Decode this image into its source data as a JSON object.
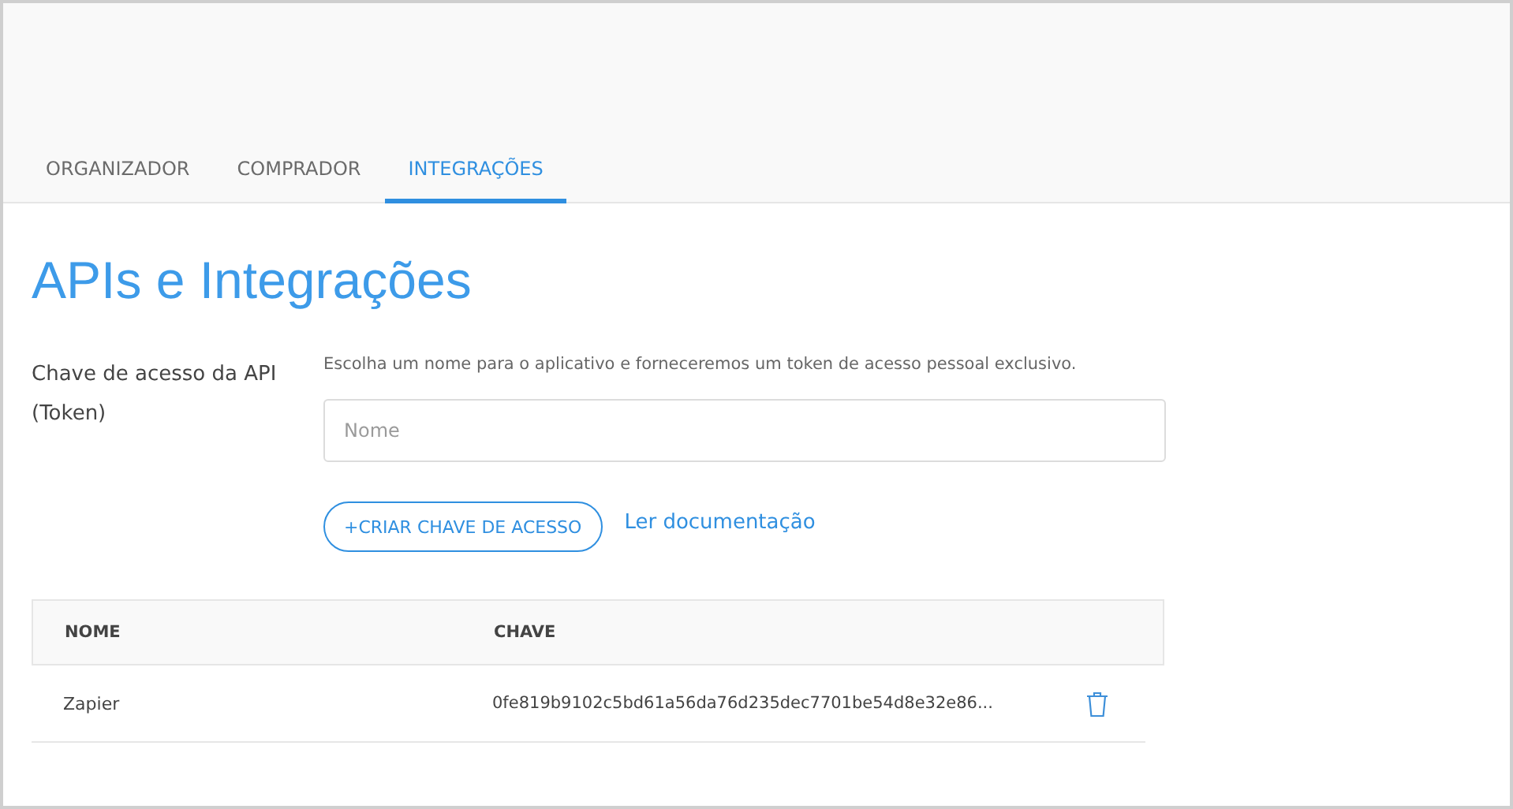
{
  "tabs": [
    {
      "label": "ORGANIZADOR",
      "selected": false
    },
    {
      "label": "COMPRADOR",
      "selected": false
    },
    {
      "label": "INTEGRAÇÕES",
      "selected": true
    }
  ],
  "title": "APIs e Integrações",
  "token_section": {
    "label": "Chave de acesso da API (Token)",
    "hint": "Escolha um nome para o aplicativo e forneceremos um token de acesso pessoal exclusivo.",
    "name_field": {
      "placeholder": "Nome"
    },
    "create_button": "+CRIAR CHAVE DE ACESSO",
    "docs_link": "Ler documentação"
  },
  "table": {
    "columns": [
      "NOME",
      "CHAVE"
    ],
    "rows": [
      {
        "name": "Zapier",
        "key": "0fe819b9102c5bd61a56da76d235dec7701be54d8e32e86..."
      }
    ]
  }
}
